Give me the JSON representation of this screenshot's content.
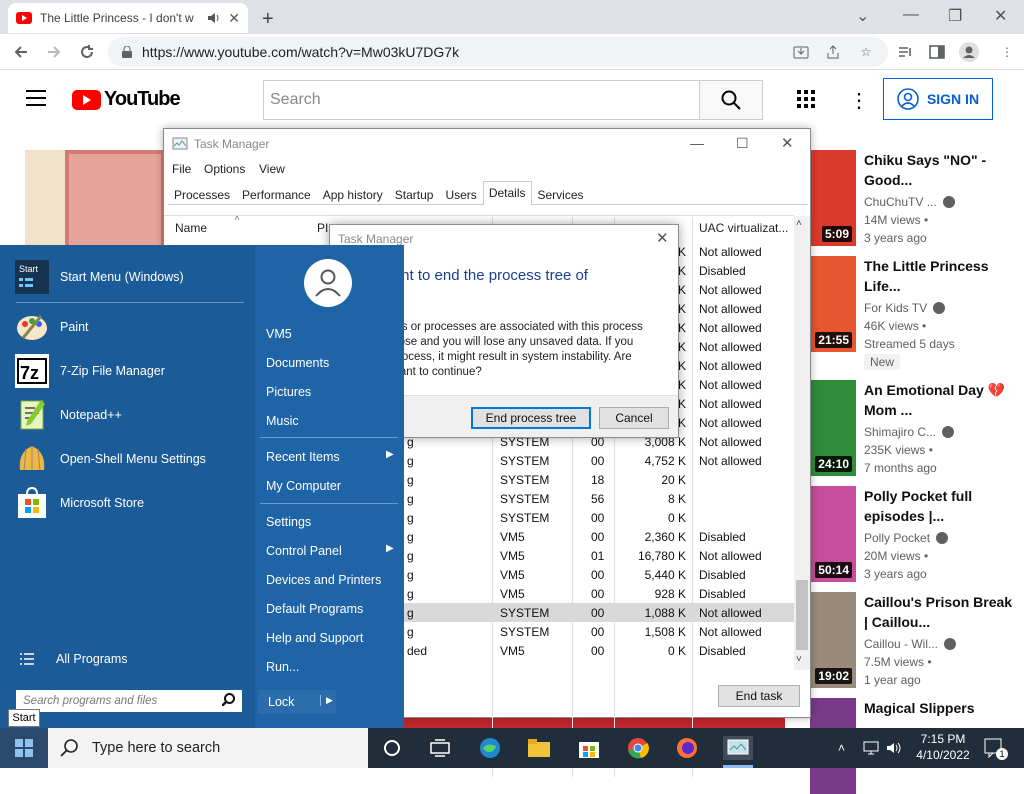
{
  "browser": {
    "tab_title": "The Little Princess - I don't w",
    "url": "https://www.youtube.com/watch?v=Mw03kU7DG7k"
  },
  "youtube": {
    "logo": "YouTube",
    "search_placeholder": "Search",
    "sign_in": "SIGN IN",
    "recommendations": [
      {
        "title": "Chiku Says \"NO\" - Good...",
        "channel": "ChuChuTV ...",
        "views": "14M views •",
        "age": "3 years ago",
        "duration": "5:09",
        "thumb_color": "#d93a2b"
      },
      {
        "title": "The Little Princess Life...",
        "channel": "For Kids TV",
        "views": "46K views •",
        "age": "Streamed 5 days",
        "badge": "New",
        "duration": "21:55",
        "thumb_color": "#e6562f"
      },
      {
        "title": "An Emotional Day 💔 Mom ...",
        "channel": "Shimajiro C...",
        "views": "235K views •",
        "age": "7 months ago",
        "duration": "24:10",
        "thumb_color": "#2f8c3b"
      },
      {
        "title": "Polly Pocket full episodes |...",
        "channel": "Polly Pocket",
        "views": "20M views •",
        "age": "3 years ago",
        "duration": "50:14",
        "thumb_color": "#c74d9a"
      },
      {
        "title": "Caillou's Prison Break | Caillou...",
        "channel": "Caillou - Wil...",
        "views": "7.5M views •",
        "age": "1 year ago",
        "duration": "19:02",
        "thumb_color": "#9a8a7a"
      },
      {
        "title": "Magical Slippers",
        "channel": "",
        "views": "",
        "age": "",
        "duration": "",
        "thumb_color": "#7a3a8a"
      }
    ]
  },
  "task_manager": {
    "title": "Task Manager",
    "menu": [
      "File",
      "Options",
      "View"
    ],
    "tabs": [
      "Processes",
      "Performance",
      "App history",
      "Startup",
      "Users",
      "Details",
      "Services"
    ],
    "active_tab": "Details",
    "columns": {
      "name": "Name",
      "pid": "PI",
      "uac": "UAC virtualizat..."
    },
    "rows": [
      {
        "name": "",
        "user": "",
        "cpu": "",
        "mem": "K",
        "uac": "Not allowed"
      },
      {
        "name": "",
        "user": "",
        "cpu": "",
        "mem": "K",
        "uac": "Disabled"
      },
      {
        "name": "",
        "user": "",
        "cpu": "",
        "mem": "K",
        "uac": "Not allowed"
      },
      {
        "name": "",
        "user": "",
        "cpu": "",
        "mem": "K",
        "uac": "Not allowed"
      },
      {
        "name": "",
        "user": "",
        "cpu": "",
        "mem": "K",
        "uac": "Not allowed"
      },
      {
        "name": "",
        "user": "",
        "cpu": "",
        "mem": "K",
        "uac": "Not allowed"
      },
      {
        "name": "",
        "user": "",
        "cpu": "",
        "mem": "K",
        "uac": "Not allowed"
      },
      {
        "name": "",
        "user": "",
        "cpu": "",
        "mem": "K",
        "uac": "Not allowed"
      },
      {
        "name": "",
        "user": "",
        "cpu": "",
        "mem": "K",
        "uac": "Not allowed"
      },
      {
        "name": "",
        "user": "",
        "cpu": "",
        "mem": "K",
        "uac": "Not allowed"
      },
      {
        "name": "g",
        "user": "SYSTEM",
        "cpu": "00",
        "mem": "3,008 K",
        "uac": "Not allowed"
      },
      {
        "name": "g",
        "user": "SYSTEM",
        "cpu": "00",
        "mem": "4,752 K",
        "uac": "Not allowed"
      },
      {
        "name": "g",
        "user": "SYSTEM",
        "cpu": "18",
        "mem": "20 K",
        "uac": ""
      },
      {
        "name": "g",
        "user": "SYSTEM",
        "cpu": "56",
        "mem": "8 K",
        "uac": ""
      },
      {
        "name": "g",
        "user": "SYSTEM",
        "cpu": "00",
        "mem": "0 K",
        "uac": ""
      },
      {
        "name": "g",
        "user": "VM5",
        "cpu": "00",
        "mem": "2,360 K",
        "uac": "Disabled"
      },
      {
        "name": "g",
        "user": "VM5",
        "cpu": "01",
        "mem": "16,780 K",
        "uac": "Not allowed"
      },
      {
        "name": "g",
        "user": "VM5",
        "cpu": "00",
        "mem": "5,440 K",
        "uac": "Disabled"
      },
      {
        "name": "g",
        "user": "VM5",
        "cpu": "00",
        "mem": "928 K",
        "uac": "Disabled"
      },
      {
        "name": "g",
        "user": "SYSTEM",
        "cpu": "00",
        "mem": "1,088 K",
        "uac": "Not allowed",
        "selected": true
      },
      {
        "name": "g",
        "user": "SYSTEM",
        "cpu": "00",
        "mem": "1,508 K",
        "uac": "Not allowed"
      },
      {
        "name": "ded",
        "user": "VM5",
        "cpu": "00",
        "mem": "0 K",
        "uac": "Disabled"
      }
    ],
    "end_task": "End task"
  },
  "dialog": {
    "title": "Task Manager",
    "question": "want to end the process tree of\nte?",
    "body": "rams or processes are associated with this process\nll close and you will lose any unsaved data. If you\nn process, it might result in system instability. Are\nu want to continue?",
    "primary": "End process tree",
    "secondary": "Cancel"
  },
  "start_menu": {
    "pinned": [
      {
        "label": "Start Menu (Windows)",
        "icon": "start-menu-icon"
      },
      {
        "label": "Paint",
        "icon": "paint-icon"
      },
      {
        "label": "7-Zip File Manager",
        "icon": "7zip-icon"
      },
      {
        "label": "Notepad++",
        "icon": "notepadpp-icon"
      },
      {
        "label": "Open-Shell Menu Settings",
        "icon": "openshell-icon"
      },
      {
        "label": "Microsoft Store",
        "icon": "store-icon"
      }
    ],
    "start_icon_text": "Start",
    "all_programs": "All Programs",
    "search_placeholder": "Search programs and files",
    "right": {
      "user": "VM5",
      "documents": "Documents",
      "pictures": "Pictures",
      "music": "Music",
      "recent": "Recent Items",
      "computer": "My Computer",
      "settings": "Settings",
      "control_panel": "Control Panel",
      "devices": "Devices and Printers",
      "default_programs": "Default Programs",
      "help": "Help and Support",
      "run": "Run..."
    },
    "lock": "Lock",
    "tooltip": "Start"
  },
  "taskbar": {
    "search_placeholder": "Type here to search",
    "time": "7:15 PM",
    "date": "4/10/2022",
    "notification_count": "1"
  }
}
